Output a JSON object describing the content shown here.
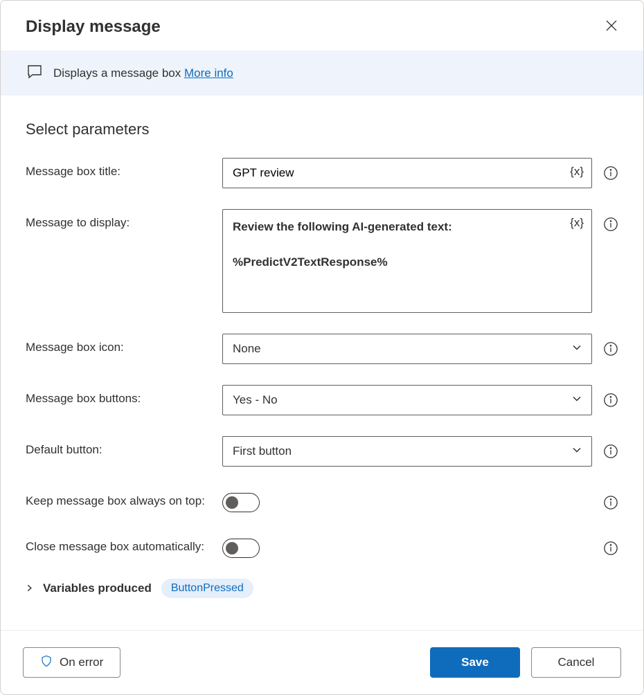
{
  "header": {
    "title": "Display message"
  },
  "banner": {
    "description": "Displays a message box ",
    "more_info": "More info"
  },
  "section": {
    "title": "Select parameters"
  },
  "fields": {
    "title": {
      "label": "Message box title:",
      "value": "GPT review",
      "var_token": "{x}"
    },
    "message": {
      "label": "Message to display:",
      "value": "Review the following AI-generated text:\n\n%PredictV2TextResponse%",
      "var_token": "{x}"
    },
    "icon": {
      "label": "Message box icon:",
      "value": "None"
    },
    "buttons": {
      "label": "Message box buttons:",
      "value": "Yes - No"
    },
    "default_button": {
      "label": "Default button:",
      "value": "First button"
    },
    "keep_on_top": {
      "label": "Keep message box always on top:",
      "value": false
    },
    "auto_close": {
      "label": "Close message box automatically:",
      "value": false
    }
  },
  "variables_produced": {
    "label": "Variables produced",
    "chip": "ButtonPressed"
  },
  "footer": {
    "on_error": "On error",
    "save": "Save",
    "cancel": "Cancel"
  }
}
